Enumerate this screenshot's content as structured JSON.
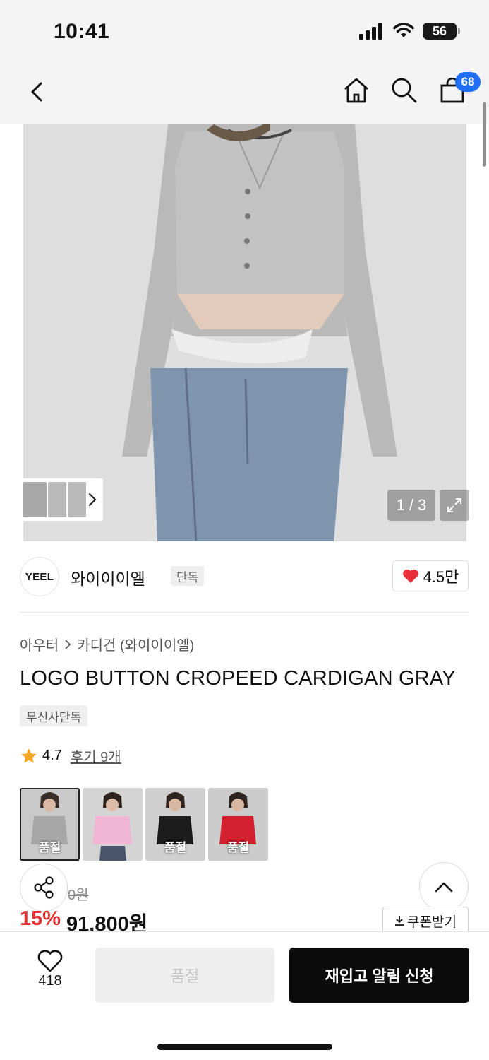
{
  "status_bar": {
    "time": "10:41",
    "battery": "56"
  },
  "nav": {
    "cart_count": "68"
  },
  "gallery": {
    "counter": "1 / 3"
  },
  "brand": {
    "logo_text": "YEEL",
    "name": "와이이이엘",
    "tag": "단독",
    "likes": "4.5만"
  },
  "breadcrumb": {
    "category": "아우터",
    "subcategory": "카디건 (와이이이엘)"
  },
  "product": {
    "title": "LOGO BUTTON CROPEED CARDIGAN GRAY",
    "exclusive_tag": "무신사단독",
    "rating": "4.7",
    "reviews": "후기 9개",
    "original_price": "0원",
    "discount": "15%",
    "price": "91,800원"
  },
  "variants": [
    {
      "label": "품절",
      "color": "gray"
    },
    {
      "label": "",
      "color": "pink"
    },
    {
      "label": "품절",
      "color": "black"
    },
    {
      "label": "품절",
      "color": "red"
    }
  ],
  "coupon": {
    "label": "쿠폰받기"
  },
  "bottom": {
    "wish_count": "418",
    "soldout_label": "품절",
    "restock_label": "재입고 알림 신청"
  },
  "colors": {
    "accent_blue": "#1f6ef5",
    "discount_red": "#e23232",
    "heart_red": "#e8303a",
    "star": "#f5a623"
  }
}
